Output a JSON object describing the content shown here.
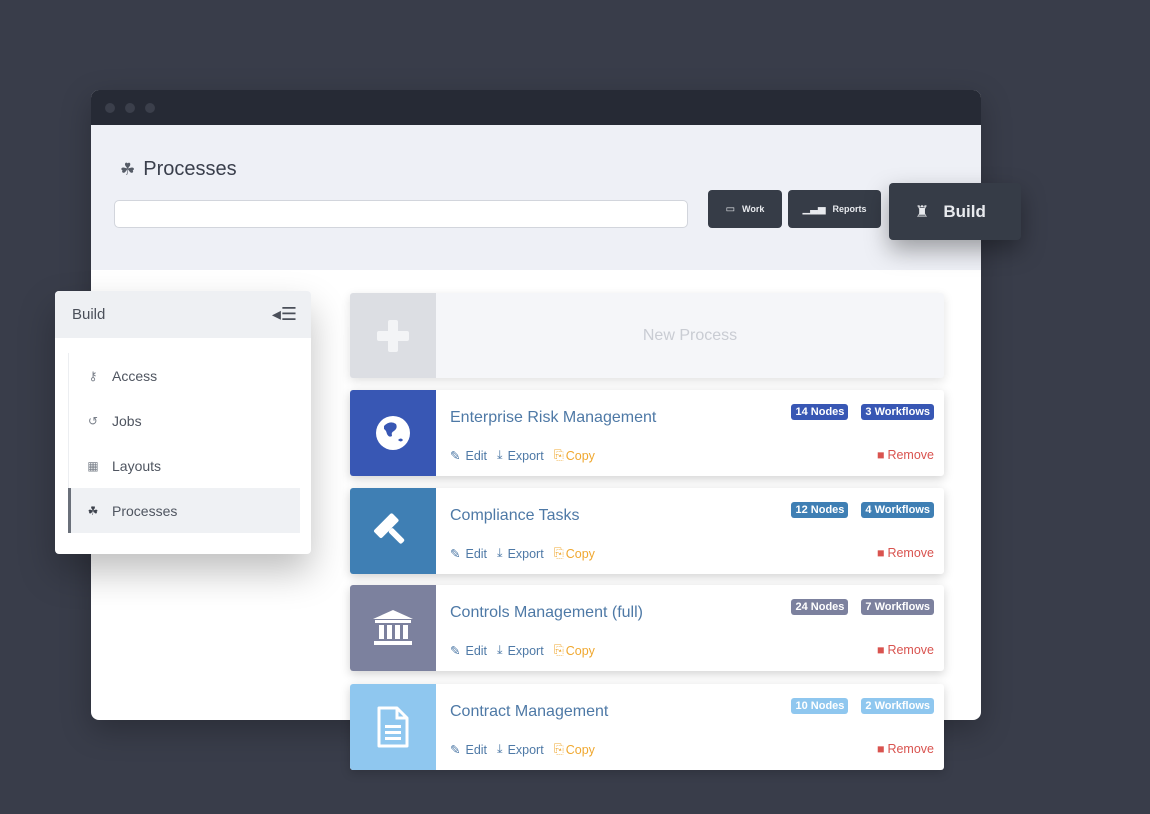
{
  "window": {
    "title": "Processes",
    "search": {
      "value": "",
      "placeholder": ""
    },
    "buttons": [
      {
        "label": "Work",
        "icon": "inbox-icon"
      },
      {
        "label": "Reports",
        "icon": "bar-chart-icon"
      }
    ],
    "active_mode": {
      "label": "Build",
      "icon": "puzzle-icon"
    }
  },
  "sidebar": {
    "title": "Build",
    "items": [
      {
        "label": "Access",
        "icon": "key-icon",
        "active": false
      },
      {
        "label": "Jobs",
        "icon": "history-icon",
        "active": false
      },
      {
        "label": "Layouts",
        "icon": "table-icon",
        "active": false
      },
      {
        "label": "Processes",
        "icon": "cubes-icon",
        "active": true
      }
    ]
  },
  "new_process": {
    "label": "New Process"
  },
  "actions": {
    "edit": "Edit",
    "export": "Export",
    "copy": "Copy",
    "remove": "Remove"
  },
  "processes": [
    {
      "name": "Enterprise Risk Management",
      "nodes": "14 Nodes",
      "workflows": "3 Workflows",
      "icon": "globe-icon",
      "color": "#3857b4"
    },
    {
      "name": "Compliance Tasks",
      "nodes": "12 Nodes",
      "workflows": "4 Workflows",
      "icon": "gavel-icon",
      "color": "#3f7fb4"
    },
    {
      "name": "Controls Management (full)",
      "nodes": "24 Nodes",
      "workflows": "7 Workflows",
      "icon": "bank-icon",
      "color": "#7c819e"
    },
    {
      "name": "Contract Management",
      "nodes": "10 Nodes",
      "workflows": "2 Workflows",
      "icon": "document-icon",
      "color": "#8fc7ef"
    }
  ]
}
